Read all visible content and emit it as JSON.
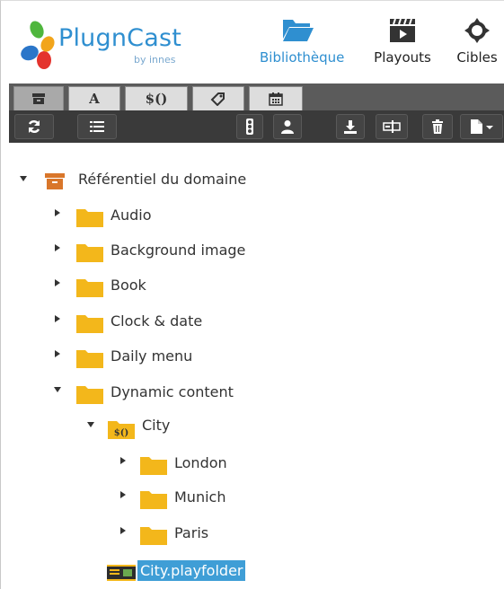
{
  "app": {
    "logo_text": "PlugnCast",
    "logo_sub": "by innes"
  },
  "nav": [
    {
      "label": "Bibliothèque",
      "icon": "folder-open-icon",
      "active": true
    },
    {
      "label": "Playouts",
      "icon": "clapperboard-icon",
      "active": false
    },
    {
      "label": "Cibles",
      "icon": "crosshair-icon",
      "active": false
    }
  ],
  "tabs": [
    {
      "icon": "archive-icon",
      "label": "",
      "active": true
    },
    {
      "icon": "font-icon",
      "label": "A",
      "active": false
    },
    {
      "icon": "variable-icon",
      "label": "$()",
      "active": false
    },
    {
      "icon": "tag-icon",
      "label": "",
      "active": false
    },
    {
      "icon": "calendar-icon",
      "label": "",
      "active": false
    }
  ],
  "toolbar": [
    {
      "icon": "refresh-icon"
    },
    {
      "icon": "list-icon"
    },
    {
      "icon": "traffic-light-icon"
    },
    {
      "icon": "user-icon"
    },
    {
      "icon": "download-icon"
    },
    {
      "icon": "rename-field-icon"
    },
    {
      "icon": "trash-icon"
    },
    {
      "icon": "new-file-menu-icon"
    }
  ],
  "tree": {
    "root": {
      "label": "Référentiel du domaine",
      "expanded": true
    },
    "items": [
      {
        "label": "Audio",
        "expanded": false
      },
      {
        "label": "Background image",
        "expanded": false
      },
      {
        "label": "Book",
        "expanded": false
      },
      {
        "label": "Clock & date",
        "expanded": false
      },
      {
        "label": "Daily menu",
        "expanded": false
      },
      {
        "label": "Dynamic content",
        "expanded": true
      }
    ],
    "city": {
      "label": "City",
      "expanded": true
    },
    "city_children": [
      {
        "label": "London",
        "expanded": false
      },
      {
        "label": "Munich",
        "expanded": false
      },
      {
        "label": "Paris",
        "expanded": false
      }
    ],
    "playfolder": {
      "label": "City.playfolder",
      "selected": true
    }
  },
  "colors": {
    "accent": "#2f8fd0",
    "folder": "#f3b71b",
    "selection": "#3f9ed6",
    "toolbar": "#3a3a3a",
    "root_icon": "#d9762a"
  }
}
